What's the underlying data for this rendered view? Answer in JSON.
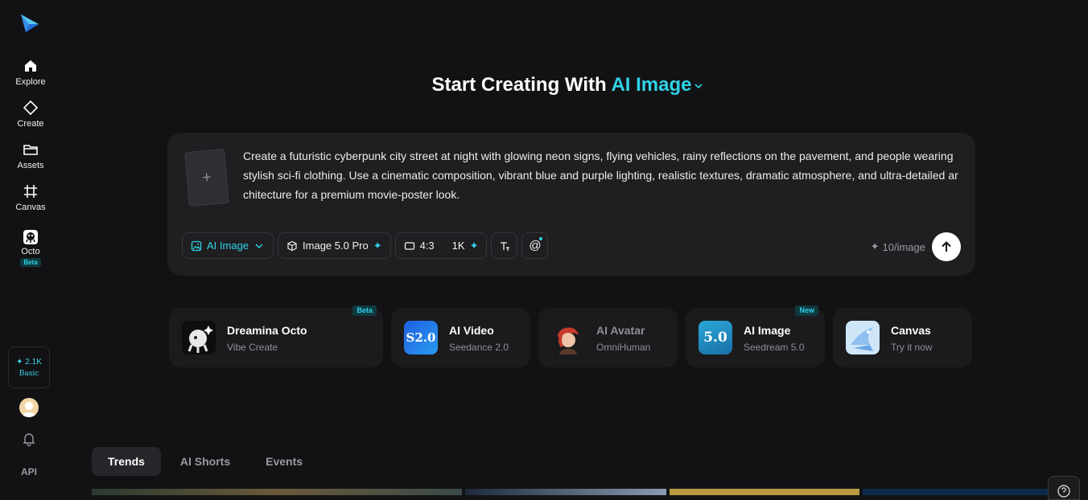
{
  "sidebar": {
    "nav": [
      {
        "label": "Explore",
        "icon": "home-icon"
      },
      {
        "label": "Create",
        "icon": "create-diamond-icon"
      },
      {
        "label": "Assets",
        "icon": "folder-icon"
      },
      {
        "label": "Canvas",
        "icon": "canvas-crop-icon"
      },
      {
        "label": "Octo",
        "icon": "octo-icon",
        "badge": "Beta"
      }
    ],
    "credits": {
      "value": "2.1K",
      "plan": "Basic"
    },
    "api_label": "API"
  },
  "headline": {
    "prefix": "Start Creating With",
    "mode": "AI Image"
  },
  "prompt": {
    "text": "Create a futuristic cyberpunk city street at night with glowing neon signs, flying vehicles, rainy reflections on the pavement, and people wearing stylish sci-fi clothing. Use a cinematic composition, vibrant blue and purple lighting, realistic textures, dramatic atmosphere, and ultra-detailed architecture for a premium movie-poster look."
  },
  "toolbar": {
    "mode": "AI Image",
    "model": "Image 5.0 Pro",
    "ratio": "4:3",
    "resolution": "1K",
    "cost": "10/image"
  },
  "features": [
    {
      "title": "Dreamina Octo",
      "subtitle": "Vibe Create",
      "badge": "Beta"
    },
    {
      "title": "AI Video",
      "subtitle": "Seedance 2.0",
      "icon_text": "S2.0"
    },
    {
      "title": "AI Avatar",
      "subtitle": "OmniHuman"
    },
    {
      "title": "AI Image",
      "subtitle": "Seedream 5.0",
      "badge": "New",
      "icon_text": "5.0"
    },
    {
      "title": "Canvas",
      "subtitle": "Try it now"
    }
  ],
  "tabs": [
    "Trends",
    "AI Shorts",
    "Events"
  ],
  "colors": {
    "accent": "#2fd2e6",
    "background": "#121214",
    "panel": "#1f1f22"
  }
}
